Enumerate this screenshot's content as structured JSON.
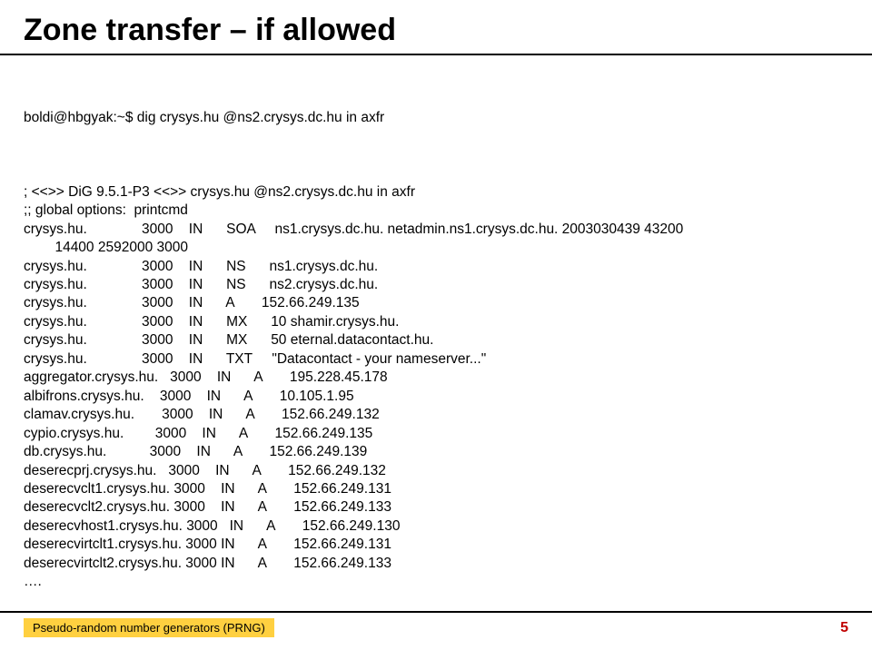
{
  "title": "Zone transfer – if allowed",
  "command": "boldi@hbgyak:~$ dig crysys.hu @ns2.crysys.dc.hu in axfr",
  "lines": [
    "",
    "; <<>> DiG 9.5.1-P3 <<>> crysys.hu @ns2.crysys.dc.hu in axfr",
    ";; global options:  printcmd",
    "crysys.hu.              3000    IN      SOA     ns1.crysys.dc.hu. netadmin.ns1.crysys.dc.hu. 2003030439 43200 ",
    "        14400 2592000 3000",
    "crysys.hu.              3000    IN      NS      ns1.crysys.dc.hu.",
    "crysys.hu.              3000    IN      NS      ns2.crysys.dc.hu.",
    "crysys.hu.              3000    IN      A       152.66.249.135",
    "crysys.hu.              3000    IN      MX      10 shamir.crysys.hu.",
    "crysys.hu.              3000    IN      MX      50 eternal.datacontact.hu.",
    "crysys.hu.              3000    IN      TXT     \"Datacontact - your nameserver...\"",
    "aggregator.crysys.hu.   3000    IN      A       195.228.45.178",
    "albifrons.crysys.hu.    3000    IN      A       10.105.1.95",
    "clamav.crysys.hu.       3000    IN      A       152.66.249.132",
    "cypio.crysys.hu.        3000    IN      A       152.66.249.135",
    "db.crysys.hu.           3000    IN      A       152.66.249.139",
    "deserecprj.crysys.hu.   3000    IN      A       152.66.249.132",
    "deserecvclt1.crysys.hu. 3000    IN      A       152.66.249.131",
    "deserecvclt2.crysys.hu. 3000    IN      A       152.66.249.133",
    "deserecvhost1.crysys.hu. 3000   IN      A       152.66.249.130",
    "deserecvirtclt1.crysys.hu. 3000 IN      A       152.66.249.131",
    "deserecvirtclt2.crysys.hu. 3000 IN      A       152.66.249.133",
    "…."
  ],
  "footer": {
    "left": "Pseudo-random number generators (PRNG)",
    "pageNumber": "5"
  }
}
